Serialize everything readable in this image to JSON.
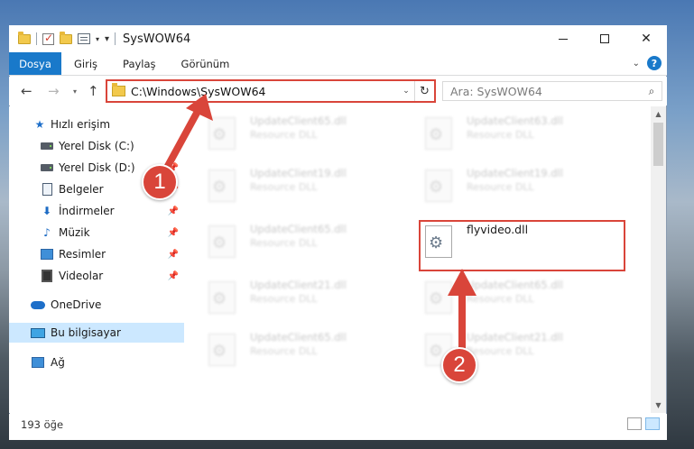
{
  "window": {
    "title": "SysWOW64"
  },
  "ribbon": {
    "tabs": [
      "Dosya",
      "Giriş",
      "Paylaş",
      "Görünüm"
    ],
    "help": "?"
  },
  "address": {
    "path": "C:\\Windows\\SysWOW64",
    "search_placeholder": "Ara: SysWOW64"
  },
  "sidebar": {
    "items": [
      {
        "label": "Hızlı erişim",
        "icon": "star-icon"
      },
      {
        "label": "Yerel Disk (C:)",
        "icon": "disk-icon"
      },
      {
        "label": "Yerel Disk (D:)",
        "icon": "disk-icon"
      },
      {
        "label": "Belgeler",
        "icon": "documents-icon"
      },
      {
        "label": "İndirmeler",
        "icon": "downloads-icon"
      },
      {
        "label": "Müzik",
        "icon": "music-icon"
      },
      {
        "label": "Resimler",
        "icon": "pictures-icon"
      },
      {
        "label": "Videolar",
        "icon": "videos-icon"
      },
      {
        "label": "OneDrive",
        "icon": "onedrive-icon"
      },
      {
        "label": "Bu bilgisayar",
        "icon": "this-pc-icon"
      },
      {
        "label": "Ağ",
        "icon": "network-icon"
      }
    ]
  },
  "files": [
    {
      "name": "UpdateClient65.dll",
      "type": "Resource DLL"
    },
    {
      "name": "UpdateClient63.dll",
      "type": "Resource DLL"
    },
    {
      "name": "UpdateClient19.dll",
      "type": "Resource DLL"
    },
    {
      "name": "UpdateClient19.dll",
      "type": "Resource DLL"
    },
    {
      "name": "UpdateClient65.dll",
      "type": "Resource DLL"
    },
    {
      "name": "flyvideo.dll",
      "type": ""
    },
    {
      "name": "UpdateClient21.dll",
      "type": "Resource DLL"
    },
    {
      "name": "UpdateClient65.dll",
      "type": "Resource DLL"
    },
    {
      "name": "UpdateClient65.dll",
      "type": "Resource DLL"
    },
    {
      "name": "UpdateClient21.dll",
      "type": "Resource DLL"
    }
  ],
  "status": {
    "count": "193 öğe"
  },
  "annotations": {
    "step1": "1",
    "step2": "2",
    "color": "#d9453a"
  }
}
